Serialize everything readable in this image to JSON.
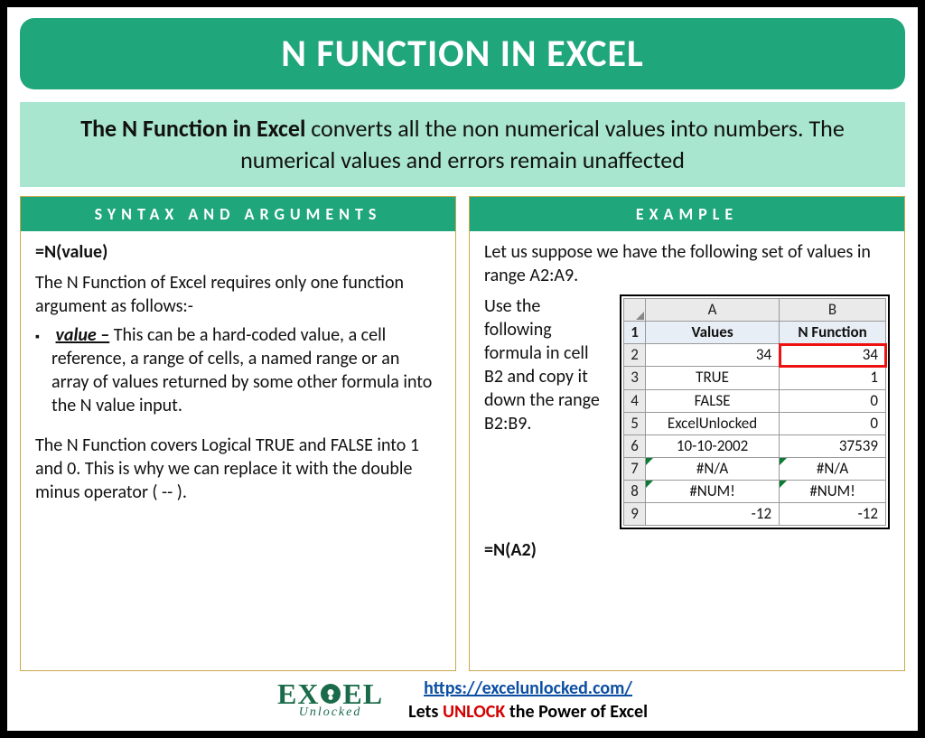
{
  "title": "N FUNCTION IN EXCEL",
  "subtitle": {
    "bold": "The N Function in Excel",
    "rest": " converts all the non numerical values into numbers. The numerical values and errors remain unaffected"
  },
  "left": {
    "header": "SYNTAX AND ARGUMENTS",
    "syntax": "=N(value)",
    "intro": "The N Function of Excel requires only one function argument as follows:-",
    "arg_name": "value –",
    "arg_desc": " This can be a hard-coded value, a cell reference, a range of cells, a named range or an array of values returned by some other formula into the N value input.",
    "note": "The N Function covers Logical TRUE and FALSE into 1 and 0. This is why we can replace it with the double minus operator ( -- )."
  },
  "right": {
    "header": "EXAMPLE",
    "intro": "Let us suppose we have the following set of values in range A2:A9.",
    "side_text": "Use the following formula in cell B2 and copy it down the range B2:B9.",
    "formula": "=N(A2)"
  },
  "table": {
    "col_a": "A",
    "col_b": "B",
    "head_a": "Values",
    "head_b": "N Function",
    "rows": [
      {
        "n": "1",
        "a": "Values",
        "b": "N Function"
      },
      {
        "n": "2",
        "a": "34",
        "b": "34"
      },
      {
        "n": "3",
        "a": "TRUE",
        "b": "1"
      },
      {
        "n": "4",
        "a": "FALSE",
        "b": "0"
      },
      {
        "n": "5",
        "a": "ExcelUnlocked",
        "b": "0"
      },
      {
        "n": "6",
        "a": "10-10-2002",
        "b": "37539"
      },
      {
        "n": "7",
        "a": "#N/A",
        "b": "#N/A"
      },
      {
        "n": "8",
        "a": "#NUM!",
        "b": "#NUM!"
      },
      {
        "n": "9",
        "a": "-12",
        "b": "-12"
      }
    ]
  },
  "footer": {
    "logo_top": "EXCEL",
    "logo_bot": "Unlocked",
    "url": "https://excelunlocked.com/",
    "tagline_pre": "Lets ",
    "tagline_mid": "UNLOCK",
    "tagline_post": " the Power of Excel"
  }
}
